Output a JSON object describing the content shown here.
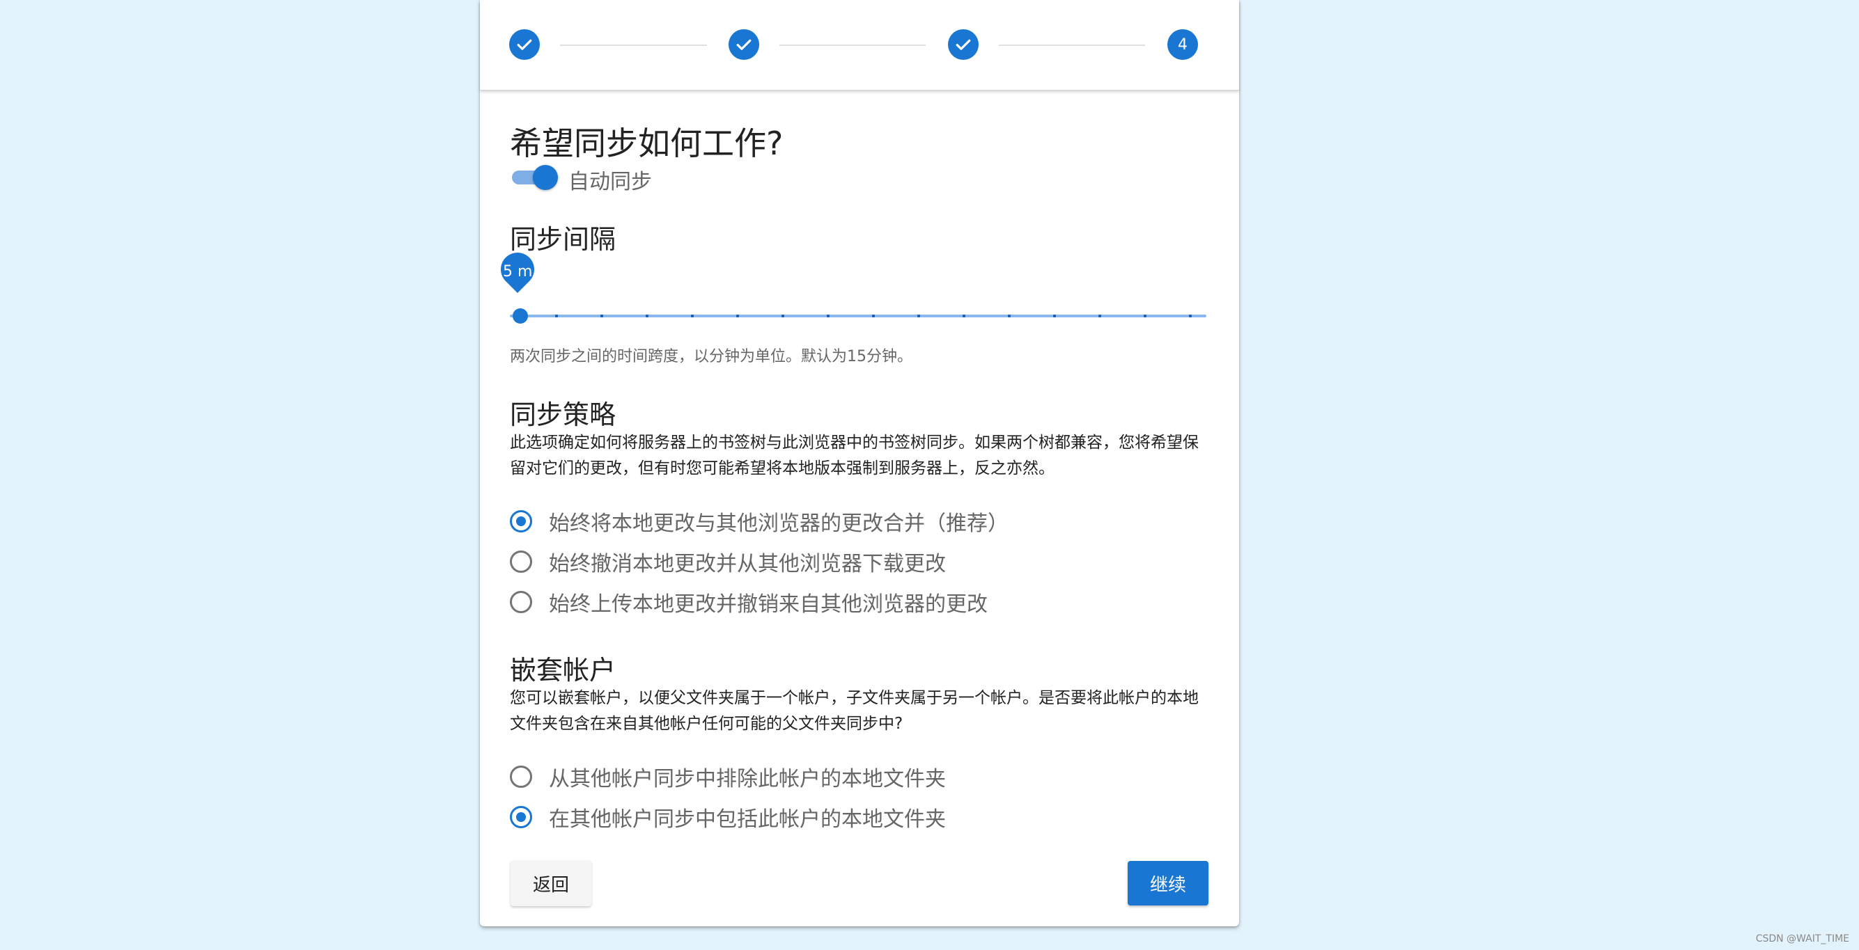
{
  "stepper": {
    "steps": [
      {
        "state": "completed",
        "icon": "check-icon"
      },
      {
        "state": "completed",
        "icon": "check-icon"
      },
      {
        "state": "completed",
        "icon": "check-icon"
      },
      {
        "state": "active",
        "label": "4"
      }
    ]
  },
  "title": "希望同步如何工作?",
  "auto_sync": {
    "label": "自动同步",
    "enabled": true
  },
  "interval": {
    "heading": "同步间隔",
    "value_label": "5 m",
    "hint": "两次同步之间的时间跨度，以分钟为单位。默认为15分钟。"
  },
  "strategy": {
    "heading": "同步策略",
    "description": "此选项确定如何将服务器上的书签树与此浏览器中的书签树同步。如果两个树都兼容，您将希望保留对它们的更改，但有时您可能希望将本地版本强制到服务器上，反之亦然。",
    "options": [
      {
        "label": "始终将本地更改与其他浏览器的更改合并（推荐）",
        "selected": true
      },
      {
        "label": "始终撤消本地更改并从其他浏览器下载更改",
        "selected": false
      },
      {
        "label": "始终上传本地更改并撤销来自其他浏览器的更改",
        "selected": false
      }
    ]
  },
  "nested": {
    "heading": "嵌套帐户",
    "description": "您可以嵌套帐户，以便父文件夹属于一个帐户，子文件夹属于另一个帐户。是否要将此帐户的本地文件夹包含在来自其他帐户任何可能的父文件夹同步中?",
    "options": [
      {
        "label": "从其他帐户同步中排除此帐户的本地文件夹",
        "selected": false
      },
      {
        "label": "在其他帐户同步中包括此帐户的本地文件夹",
        "selected": true
      }
    ]
  },
  "buttons": {
    "back": "返回",
    "next": "继续"
  },
  "watermark": "CSDN @WAIT_TIME",
  "colors": {
    "primary": "#1976d2",
    "background": "#e3f3fc"
  }
}
